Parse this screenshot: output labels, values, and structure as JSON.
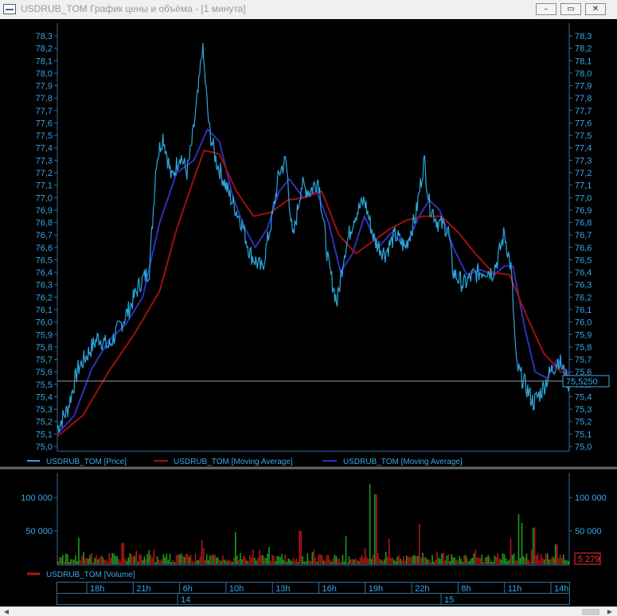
{
  "window": {
    "title": "USDRUB_TOM График цены и объёма - [1 минута]",
    "minimize_glyph": "–",
    "maximize_glyph": "▭",
    "close_glyph": "✕"
  },
  "colors": {
    "background": "#000000",
    "axis": "#38a8e8",
    "price_line": "#2aa7dc",
    "ma_slow": "#a01010",
    "ma_fast": "#3030b8",
    "volume_up": "#1f9a1f",
    "volume_down": "#b01818",
    "last_volume_text": "#ff3030"
  },
  "chart_data": [
    {
      "type": "line",
      "ylim": [
        75.0,
        78.3
      ],
      "y_ticks": [
        "78,3",
        "78,2",
        "78,1",
        "78,0",
        "77,9",
        "77,8",
        "77,7",
        "77,6",
        "77,5",
        "77,4",
        "77,3",
        "77,2",
        "77,1",
        "77,0",
        "76,9",
        "76,8",
        "76,7",
        "76,6",
        "76,5",
        "76,4",
        "76,3",
        "76,2",
        "76,1",
        "76,0",
        "75,9",
        "75,8",
        "75,7",
        "75,6",
        "75,5",
        "75,4",
        "75,3",
        "75,2",
        "75,1",
        "75,0"
      ],
      "last_price_label": "75,5250",
      "last_price": 75.525,
      "grid": false,
      "legend_position": "bottom",
      "series": [
        {
          "name": "USDRUB_TOM [Price]",
          "color": "#2aa7dc",
          "points": [
            [
              0,
              75.15
            ],
            [
              0.6,
              75.3
            ],
            [
              1.2,
              75.62
            ],
            [
              1.8,
              75.75
            ],
            [
              2.4,
              75.88
            ],
            [
              3,
              75.8
            ],
            [
              3.6,
              75.95
            ],
            [
              4.2,
              76.1
            ],
            [
              4.8,
              76.3
            ],
            [
              5.4,
              76.42
            ],
            [
              5.8,
              77.3
            ],
            [
              6.2,
              77.5
            ],
            [
              6.7,
              77.15
            ],
            [
              7.2,
              77.35
            ],
            [
              7.6,
              77.2
            ],
            [
              7.9,
              77.45
            ],
            [
              8.3,
              77.9
            ],
            [
              8.5,
              78.22
            ],
            [
              8.9,
              77.55
            ],
            [
              9.3,
              77.3
            ],
            [
              10,
              77.05
            ],
            [
              10.8,
              76.8
            ],
            [
              11.3,
              76.55
            ],
            [
              12,
              76.42
            ],
            [
              12.6,
              76.85
            ],
            [
              13,
              77.2
            ],
            [
              13.4,
              77.3
            ],
            [
              13.8,
              76.65
            ],
            [
              14.3,
              77.1
            ],
            [
              14.8,
              77.05
            ],
            [
              15.3,
              77.15
            ],
            [
              15.9,
              76.45
            ],
            [
              16.4,
              76.15
            ],
            [
              16.8,
              76.55
            ],
            [
              17.4,
              76.85
            ],
            [
              18,
              76.98
            ],
            [
              18.6,
              76.65
            ],
            [
              19.2,
              76.55
            ],
            [
              19.8,
              76.7
            ],
            [
              20.4,
              76.6
            ],
            [
              21,
              76.85
            ],
            [
              21.5,
              77.3
            ],
            [
              21.8,
              76.95
            ],
            [
              22.3,
              76.8
            ],
            [
              22.9,
              76.75
            ],
            [
              23.2,
              76.4
            ],
            [
              23.8,
              76.3
            ],
            [
              24.4,
              76.38
            ],
            [
              25.1,
              76.42
            ],
            [
              25.5,
              76.4
            ],
            [
              25.8,
              76.5
            ],
            [
              26.2,
              76.72
            ],
            [
              26.6,
              76.42
            ],
            [
              26.9,
              75.65
            ],
            [
              27.4,
              75.5
            ],
            [
              27.9,
              75.35
            ],
            [
              28.4,
              75.45
            ],
            [
              28.9,
              75.6
            ],
            [
              29.4,
              75.7
            ],
            [
              29.8,
              75.55
            ],
            [
              30,
              75.5
            ]
          ]
        },
        {
          "name": "USDRUB_TOM [Moving Average]",
          "color": "#a01010",
          "points": [
            [
              0,
              75.08
            ],
            [
              1.5,
              75.25
            ],
            [
              3,
              75.6
            ],
            [
              4.5,
              75.9
            ],
            [
              6,
              76.25
            ],
            [
              7,
              76.75
            ],
            [
              8,
              77.15
            ],
            [
              8.6,
              77.38
            ],
            [
              9.5,
              77.35
            ],
            [
              10.5,
              77.05
            ],
            [
              11.5,
              76.85
            ],
            [
              12.5,
              76.88
            ],
            [
              13.5,
              76.98
            ],
            [
              14.5,
              77.0
            ],
            [
              15.5,
              77.05
            ],
            [
              16.5,
              76.7
            ],
            [
              17.5,
              76.55
            ],
            [
              18.5,
              76.65
            ],
            [
              19.5,
              76.75
            ],
            [
              20.5,
              76.82
            ],
            [
              21.5,
              76.85
            ],
            [
              22.5,
              76.85
            ],
            [
              23.5,
              76.72
            ],
            [
              24.5,
              76.55
            ],
            [
              25.5,
              76.4
            ],
            [
              26.5,
              76.38
            ],
            [
              27.5,
              76.05
            ],
            [
              28.5,
              75.75
            ],
            [
              29.5,
              75.6
            ],
            [
              30,
              75.58
            ]
          ]
        },
        {
          "name": "USDRUB_TOM [Moving Average]",
          "color": "#3030b8",
          "points": [
            [
              0,
              75.1
            ],
            [
              1,
              75.25
            ],
            [
              2,
              75.62
            ],
            [
              3,
              75.85
            ],
            [
              4,
              75.98
            ],
            [
              5,
              76.2
            ],
            [
              6,
              76.8
            ],
            [
              7,
              77.2
            ],
            [
              8,
              77.3
            ],
            [
              8.8,
              77.55
            ],
            [
              9.5,
              77.45
            ],
            [
              10.3,
              77.0
            ],
            [
              11,
              76.75
            ],
            [
              11.6,
              76.6
            ],
            [
              12.3,
              76.75
            ],
            [
              13,
              77.05
            ],
            [
              13.6,
              77.15
            ],
            [
              14.4,
              77.0
            ],
            [
              15.2,
              77.05
            ],
            [
              15.9,
              76.8
            ],
            [
              16.6,
              76.4
            ],
            [
              17.3,
              76.55
            ],
            [
              18,
              76.85
            ],
            [
              18.8,
              76.6
            ],
            [
              19.6,
              76.72
            ],
            [
              20.4,
              76.6
            ],
            [
              21.2,
              76.85
            ],
            [
              21.8,
              76.98
            ],
            [
              22.4,
              76.9
            ],
            [
              23.2,
              76.6
            ],
            [
              24,
              76.38
            ],
            [
              24.8,
              76.42
            ],
            [
              25.6,
              76.38
            ],
            [
              26.2,
              76.45
            ],
            [
              26.7,
              76.45
            ],
            [
              27.4,
              75.95
            ],
            [
              28,
              75.6
            ],
            [
              28.7,
              75.55
            ],
            [
              29.3,
              75.7
            ],
            [
              30,
              75.58
            ]
          ]
        }
      ]
    },
    {
      "type": "bar",
      "ylim": [
        0,
        130000
      ],
      "y_ticks": [
        "100 000",
        "50 000"
      ],
      "y_tick_values": [
        100000,
        50000
      ],
      "last_value_label": "5 279",
      "legend_position": "bottom",
      "series": [
        {
          "name": "USDRUB_TOM [Volume]",
          "color": "#a01010",
          "spikes": [
            [
              7.6,
              15000
            ],
            [
              18.3,
              120000
            ],
            [
              18.6,
              105000
            ],
            [
              23.6,
              8000
            ],
            [
              26.5,
              38000
            ],
            [
              14.2,
              50000
            ],
            [
              21.2,
              60000
            ],
            [
              27.9,
              55000
            ],
            [
              27.0,
              75000
            ],
            [
              27.2,
              62000
            ],
            [
              10.4,
              48000
            ],
            [
              1.2,
              40000
            ],
            [
              19.4,
              38000
            ],
            [
              24.5,
              22000
            ],
            [
              3.8,
              32000
            ],
            [
              16.9,
              42000
            ],
            [
              29.2,
              30000
            ],
            [
              12.4,
              26000
            ],
            [
              8.4,
              36000
            ],
            [
              5.6,
              22000
            ]
          ]
        }
      ]
    }
  ],
  "legend_main": [
    {
      "label": "USDRUB_TOM [Price]",
      "color": "#2aa7dc"
    },
    {
      "label": "USDRUB_TOM [Moving Average]",
      "color": "#a01010"
    },
    {
      "label": "USDRUB_TOM [Moving Average]",
      "color": "#3030b8"
    }
  ],
  "legend_volume": [
    {
      "label": "USDRUB_TOM [Volume]",
      "color": "#b01818"
    }
  ],
  "time_axis": {
    "hours": [
      "18h",
      "21h",
      "6h",
      "10h",
      "13h",
      "16h",
      "19h",
      "22h",
      "8h",
      "11h",
      "14h"
    ],
    "days": [
      "14",
      "15"
    ]
  }
}
